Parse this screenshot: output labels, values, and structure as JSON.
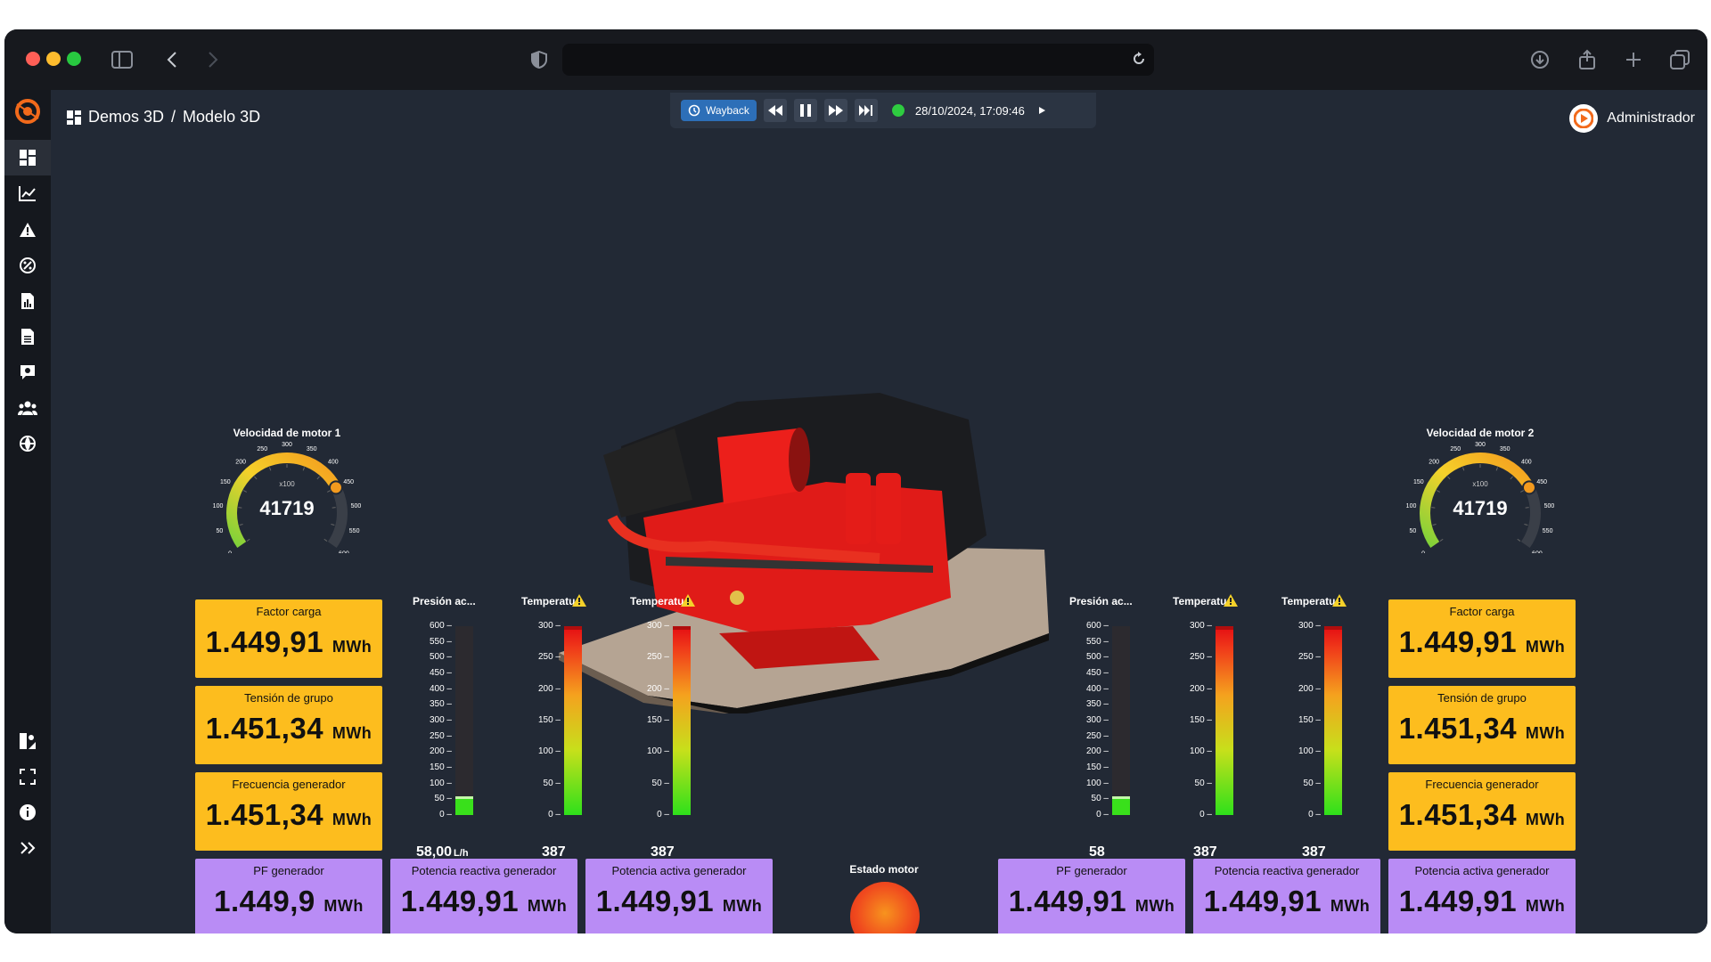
{
  "breadcrumb": {
    "part1": "Demos 3D",
    "sep": "/",
    "part2": "Modelo 3D"
  },
  "player": {
    "wayback_label": "Wayback",
    "datetime": "28/10/2024, 17:09:46",
    "live_color": "#2ecc40"
  },
  "user": {
    "name": "Administrador"
  },
  "gauge1": {
    "title": "Velocidad de motor 1",
    "value": "41719",
    "multiplier": "x100",
    "ticks": [
      "0",
      "50",
      "100",
      "150",
      "200",
      "250",
      "300",
      "350",
      "400",
      "450",
      "500",
      "550",
      "600"
    ],
    "level": 0.75
  },
  "gauge2": {
    "title": "Velocidad de motor 2",
    "value": "41719",
    "multiplier": "x100",
    "ticks": [
      "0",
      "50",
      "100",
      "150",
      "200",
      "250",
      "300",
      "350",
      "400",
      "450",
      "500",
      "550",
      "600"
    ],
    "level": 0.75
  },
  "left_cards": {
    "factor": {
      "label": "Factor carga",
      "value": "1.449,91",
      "unit": "MWh"
    },
    "tension": {
      "label": "Tensión de grupo",
      "value": "1.451,34",
      "unit": "MWh"
    },
    "frecuencia": {
      "label": "Frecuencia generador",
      "value": "1.451,34",
      "unit": "MWh"
    },
    "pf": {
      "label": "PF generador",
      "value": "1.449,9",
      "unit": "MWh"
    },
    "reactiva": {
      "label": "Potencia reactiva generador",
      "value": "1.449,91",
      "unit": "MWh"
    },
    "activa": {
      "label": "Potencia activa generador",
      "value": "1.449,91",
      "unit": "MWh"
    }
  },
  "right_cards": {
    "factor": {
      "label": "Factor carga",
      "value": "1.449,91",
      "unit": "MWh"
    },
    "tension": {
      "label": "Tensión de grupo",
      "value": "1.451,34",
      "unit": "MWh"
    },
    "frecuencia": {
      "label": "Frecuencia generador",
      "value": "1.451,34",
      "unit": "MWh"
    },
    "pf": {
      "label": "PF generador",
      "value": "1.449,91",
      "unit": "MWh"
    },
    "reactiva": {
      "label": "Potencia reactiva generador",
      "value": "1.449,91",
      "unit": "MWh"
    },
    "activa": {
      "label": "Potencia activa generador",
      "value": "1.449,91",
      "unit": "MWh"
    }
  },
  "bars_left": {
    "presion": {
      "title": "Presión ac...",
      "value": "58,00",
      "unit": "L/h",
      "ticks": [
        "600",
        "550",
        "500",
        "450",
        "400",
        "350",
        "300",
        "250",
        "200",
        "150",
        "100",
        "50",
        "0"
      ],
      "level": 0.097
    },
    "temp1": {
      "title": "Temperatu...",
      "value": "387",
      "ticks": [
        "300",
        "250",
        "200",
        "150",
        "100",
        "50",
        "0"
      ],
      "level": 1.0
    },
    "temp2": {
      "title": "Temperatu...",
      "value": "387",
      "ticks": [
        "300",
        "250",
        "200",
        "150",
        "100",
        "50",
        "0"
      ],
      "level": 1.0
    }
  },
  "bars_right": {
    "presion": {
      "title": "Presión ac...",
      "value": "58",
      "ticks": [
        "600",
        "550",
        "500",
        "450",
        "400",
        "350",
        "300",
        "250",
        "200",
        "150",
        "100",
        "50",
        "0"
      ],
      "level": 0.097
    },
    "temp1": {
      "title": "Temperatu...",
      "value": "387",
      "ticks": [
        "300",
        "250",
        "200",
        "150",
        "100",
        "50",
        "0"
      ],
      "level": 1.0
    },
    "temp2": {
      "title": "Temperatu...",
      "value": "387",
      "ticks": [
        "300",
        "250",
        "200",
        "150",
        "100",
        "50",
        "0"
      ],
      "level": 1.0
    }
  },
  "estado": {
    "title": "Estado motor",
    "color": "#f04a1e"
  },
  "sidebar_icons": [
    "dashboard-icon",
    "chart-line-icon",
    "alert-icon",
    "percent-icon",
    "report-icon",
    "document-icon",
    "comment-icon",
    "users-icon",
    "globe-icon"
  ],
  "sidebar_bottom_icons": [
    "theme-icon",
    "fullscreen-icon",
    "info-icon",
    "expand-icon"
  ]
}
